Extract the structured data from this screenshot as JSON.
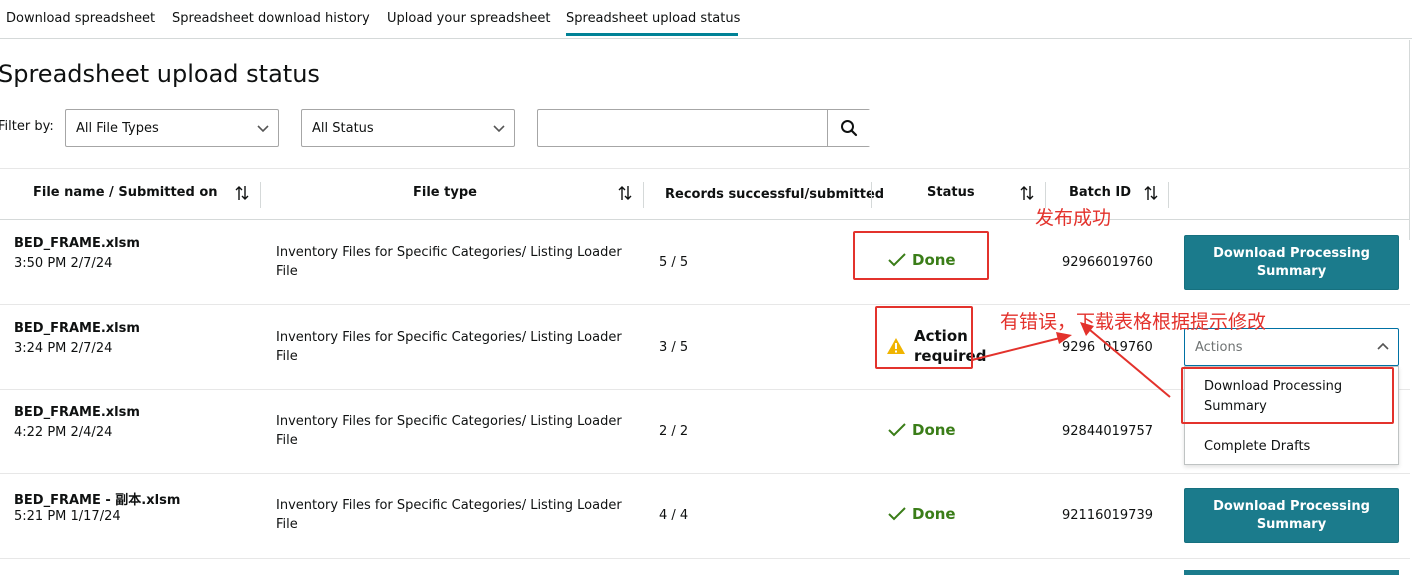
{
  "tabs": [
    {
      "label": "Download spreadsheet"
    },
    {
      "label": "Spreadsheet download history"
    },
    {
      "label": "Upload your spreadsheet"
    },
    {
      "label": "Spreadsheet upload status",
      "active": true
    }
  ],
  "page_title": "Spreadsheet upload status",
  "filters": {
    "label": "Filter by:",
    "file_type": "All File Types",
    "status": "All Status",
    "search_value": ""
  },
  "table": {
    "columns": [
      "File name / Submitted on",
      "File type",
      "Records successful/submitted",
      "Status",
      "Batch ID"
    ],
    "rows": [
      {
        "file_name": "BED_FRAME.xlsm",
        "submitted": "3:50 PM 2/7/24",
        "file_type": "Inventory Files for Specific Categories/ Listing Loader File",
        "records": "5 / 5",
        "status": "Done",
        "batch_id": "92966019760",
        "action": "Download Processing Summary"
      },
      {
        "file_name": "BED_FRAME.xlsm",
        "submitted": "3:24 PM 2/7/24",
        "file_type": "Inventory Files for Specific Categories/ Listing Loader File",
        "records": "3 / 5",
        "status": "Action required",
        "batch_id_left": "9296",
        "batch_id_right": "019760",
        "action": "Actions"
      },
      {
        "file_name": "BED_FRAME.xlsm",
        "submitted": "4:22 PM 2/4/24",
        "file_type": "Inventory Files for Specific Categories/ Listing Loader File",
        "records": "2 / 2",
        "status": "Done",
        "batch_id": "92844019757"
      },
      {
        "file_name": "BED_FRAME - 副本.xlsm",
        "submitted": "5:21 PM 1/17/24",
        "file_type": "Inventory Files for Specific Categories/ Listing Loader File",
        "records": "4 / 4",
        "status": "Done",
        "batch_id": "92116019739",
        "action": "Download Processing Summary"
      }
    ]
  },
  "actions_menu": {
    "items": [
      "Download Processing Summary",
      "Complete Drafts"
    ]
  },
  "annotations": {
    "success_note": "发布成功",
    "error_note": "有错误，下载表格根据提示修改",
    "color": "#e3322c"
  },
  "colors": {
    "accent": "#008296",
    "button": "#1b7b8c",
    "done": "#3a7d18",
    "warning": "#f0b400"
  }
}
